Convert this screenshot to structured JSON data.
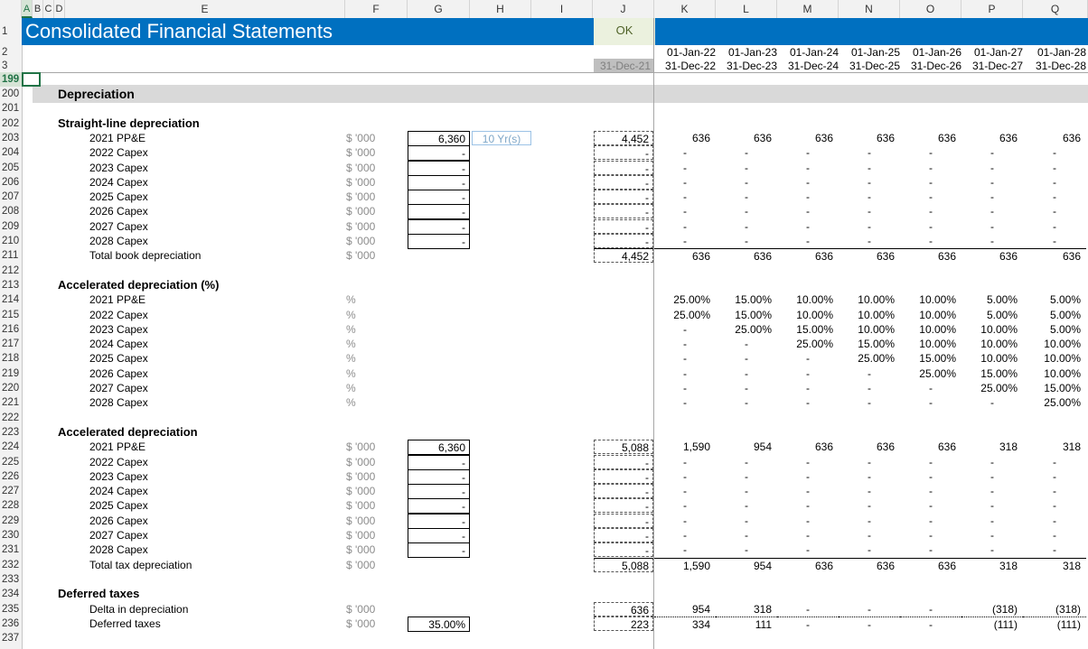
{
  "columns": [
    "A",
    "B",
    "C",
    "D",
    "E",
    "F",
    "G",
    "H",
    "I",
    "J",
    "K",
    "L",
    "M",
    "N",
    "O",
    "P",
    "Q"
  ],
  "title": "Consolidated Financial Statements",
  "status": "OK",
  "header_dates": {
    "start_row": [
      "01-Jan-22",
      "01-Jan-23",
      "01-Jan-24",
      "01-Jan-25",
      "01-Jan-26",
      "01-Jan-27",
      "01-Jan-28"
    ],
    "end_row": [
      "31-Dec-22",
      "31-Dec-23",
      "31-Dec-24",
      "31-Dec-25",
      "31-Dec-26",
      "31-Dec-27",
      "31-Dec-28"
    ],
    "prior_end": "31-Dec-21"
  },
  "row_numbers": [
    "1",
    "2",
    "3",
    "199",
    "200",
    "201",
    "202",
    "203",
    "204",
    "205",
    "206",
    "207",
    "208",
    "209",
    "210",
    "211",
    "212",
    "213",
    "214",
    "215",
    "216",
    "217",
    "218",
    "219",
    "220",
    "221",
    "222",
    "223",
    "224",
    "225",
    "226",
    "227",
    "228",
    "229",
    "230",
    "231",
    "232",
    "233",
    "234",
    "235",
    "236",
    "237"
  ],
  "section": "Depreciation",
  "straight_line": {
    "heading": "Straight-line depreciation",
    "years_label": "10 Yr(s)",
    "rows": [
      {
        "label": "2021 PP&E",
        "unit": "$ '000",
        "input": "6,360",
        "j": "4,452",
        "vals": [
          "636",
          "636",
          "636",
          "636",
          "636",
          "636",
          "636"
        ]
      },
      {
        "label": "2022 Capex",
        "unit": "$ '000",
        "input": "-",
        "j": "-",
        "vals": [
          "-",
          "-",
          "-",
          "-",
          "-",
          "-",
          "-"
        ]
      },
      {
        "label": "2023 Capex",
        "unit": "$ '000",
        "input": "-",
        "j": "-",
        "vals": [
          "-",
          "-",
          "-",
          "-",
          "-",
          "-",
          "-"
        ]
      },
      {
        "label": "2024 Capex",
        "unit": "$ '000",
        "input": "-",
        "j": "-",
        "vals": [
          "-",
          "-",
          "-",
          "-",
          "-",
          "-",
          "-"
        ]
      },
      {
        "label": "2025 Capex",
        "unit": "$ '000",
        "input": "-",
        "j": "-",
        "vals": [
          "-",
          "-",
          "-",
          "-",
          "-",
          "-",
          "-"
        ]
      },
      {
        "label": "2026 Capex",
        "unit": "$ '000",
        "input": "-",
        "j": "-",
        "vals": [
          "-",
          "-",
          "-",
          "-",
          "-",
          "-",
          "-"
        ]
      },
      {
        "label": "2027 Capex",
        "unit": "$ '000",
        "input": "-",
        "j": "-",
        "vals": [
          "-",
          "-",
          "-",
          "-",
          "-",
          "-",
          "-"
        ]
      },
      {
        "label": "2028 Capex",
        "unit": "$ '000",
        "input": "-",
        "j": "-",
        "vals": [
          "-",
          "-",
          "-",
          "-",
          "-",
          "-",
          "-"
        ]
      }
    ],
    "total": {
      "label": "Total book depreciation",
      "unit": "$ '000",
      "j": "4,452",
      "vals": [
        "636",
        "636",
        "636",
        "636",
        "636",
        "636",
        "636"
      ]
    }
  },
  "accel_pct": {
    "heading": "Accelerated depreciation (%)",
    "rows": [
      {
        "label": "2021 PP&E",
        "unit": "%",
        "vals": [
          "25.00%",
          "15.00%",
          "10.00%",
          "10.00%",
          "10.00%",
          "5.00%",
          "5.00%"
        ]
      },
      {
        "label": "2022 Capex",
        "unit": "%",
        "vals": [
          "25.00%",
          "15.00%",
          "10.00%",
          "10.00%",
          "10.00%",
          "5.00%",
          "5.00%"
        ]
      },
      {
        "label": "2023 Capex",
        "unit": "%",
        "vals": [
          "-",
          "25.00%",
          "15.00%",
          "10.00%",
          "10.00%",
          "10.00%",
          "5.00%"
        ]
      },
      {
        "label": "2024 Capex",
        "unit": "%",
        "vals": [
          "-",
          "-",
          "25.00%",
          "15.00%",
          "10.00%",
          "10.00%",
          "10.00%"
        ]
      },
      {
        "label": "2025 Capex",
        "unit": "%",
        "vals": [
          "-",
          "-",
          "-",
          "25.00%",
          "15.00%",
          "10.00%",
          "10.00%"
        ]
      },
      {
        "label": "2026 Capex",
        "unit": "%",
        "vals": [
          "-",
          "-",
          "-",
          "-",
          "25.00%",
          "15.00%",
          "10.00%"
        ]
      },
      {
        "label": "2027 Capex",
        "unit": "%",
        "vals": [
          "-",
          "-",
          "-",
          "-",
          "-",
          "25.00%",
          "15.00%"
        ]
      },
      {
        "label": "2028 Capex",
        "unit": "%",
        "vals": [
          "-",
          "-",
          "-",
          "-",
          "-",
          "-",
          "25.00%"
        ]
      }
    ]
  },
  "accel": {
    "heading": "Accelerated depreciation",
    "rows": [
      {
        "label": "2021 PP&E",
        "unit": "$ '000",
        "input": "6,360",
        "j": "5,088",
        "vals": [
          "1,590",
          "954",
          "636",
          "636",
          "636",
          "318",
          "318"
        ]
      },
      {
        "label": "2022 Capex",
        "unit": "$ '000",
        "input": "-",
        "j": "-",
        "vals": [
          "-",
          "-",
          "-",
          "-",
          "-",
          "-",
          "-"
        ]
      },
      {
        "label": "2023 Capex",
        "unit": "$ '000",
        "input": "-",
        "j": "-",
        "vals": [
          "-",
          "-",
          "-",
          "-",
          "-",
          "-",
          "-"
        ]
      },
      {
        "label": "2024 Capex",
        "unit": "$ '000",
        "input": "-",
        "j": "-",
        "vals": [
          "-",
          "-",
          "-",
          "-",
          "-",
          "-",
          "-"
        ]
      },
      {
        "label": "2025 Capex",
        "unit": "$ '000",
        "input": "-",
        "j": "-",
        "vals": [
          "-",
          "-",
          "-",
          "-",
          "-",
          "-",
          "-"
        ]
      },
      {
        "label": "2026 Capex",
        "unit": "$ '000",
        "input": "-",
        "j": "-",
        "vals": [
          "-",
          "-",
          "-",
          "-",
          "-",
          "-",
          "-"
        ]
      },
      {
        "label": "2027 Capex",
        "unit": "$ '000",
        "input": "-",
        "j": "-",
        "vals": [
          "-",
          "-",
          "-",
          "-",
          "-",
          "-",
          "-"
        ]
      },
      {
        "label": "2028 Capex",
        "unit": "$ '000",
        "input": "-",
        "j": "-",
        "vals": [
          "-",
          "-",
          "-",
          "-",
          "-",
          "-",
          "-"
        ]
      }
    ],
    "total": {
      "label": "Total tax depreciation",
      "unit": "$ '000",
      "j": "5,088",
      "vals": [
        "1,590",
        "954",
        "636",
        "636",
        "636",
        "318",
        "318"
      ]
    }
  },
  "deferred": {
    "heading": "Deferred taxes",
    "delta": {
      "label": "Delta in depreciation",
      "unit": "$ '000",
      "j": "636",
      "vals": [
        "954",
        "318",
        "-",
        "-",
        "-",
        "(318)",
        "(318)"
      ]
    },
    "taxes": {
      "label": "Deferred taxes",
      "unit": "$ '000",
      "input": "35.00%",
      "j": "223",
      "vals": [
        "334",
        "111",
        "-",
        "-",
        "-",
        "(111)",
        "(111)"
      ]
    }
  }
}
